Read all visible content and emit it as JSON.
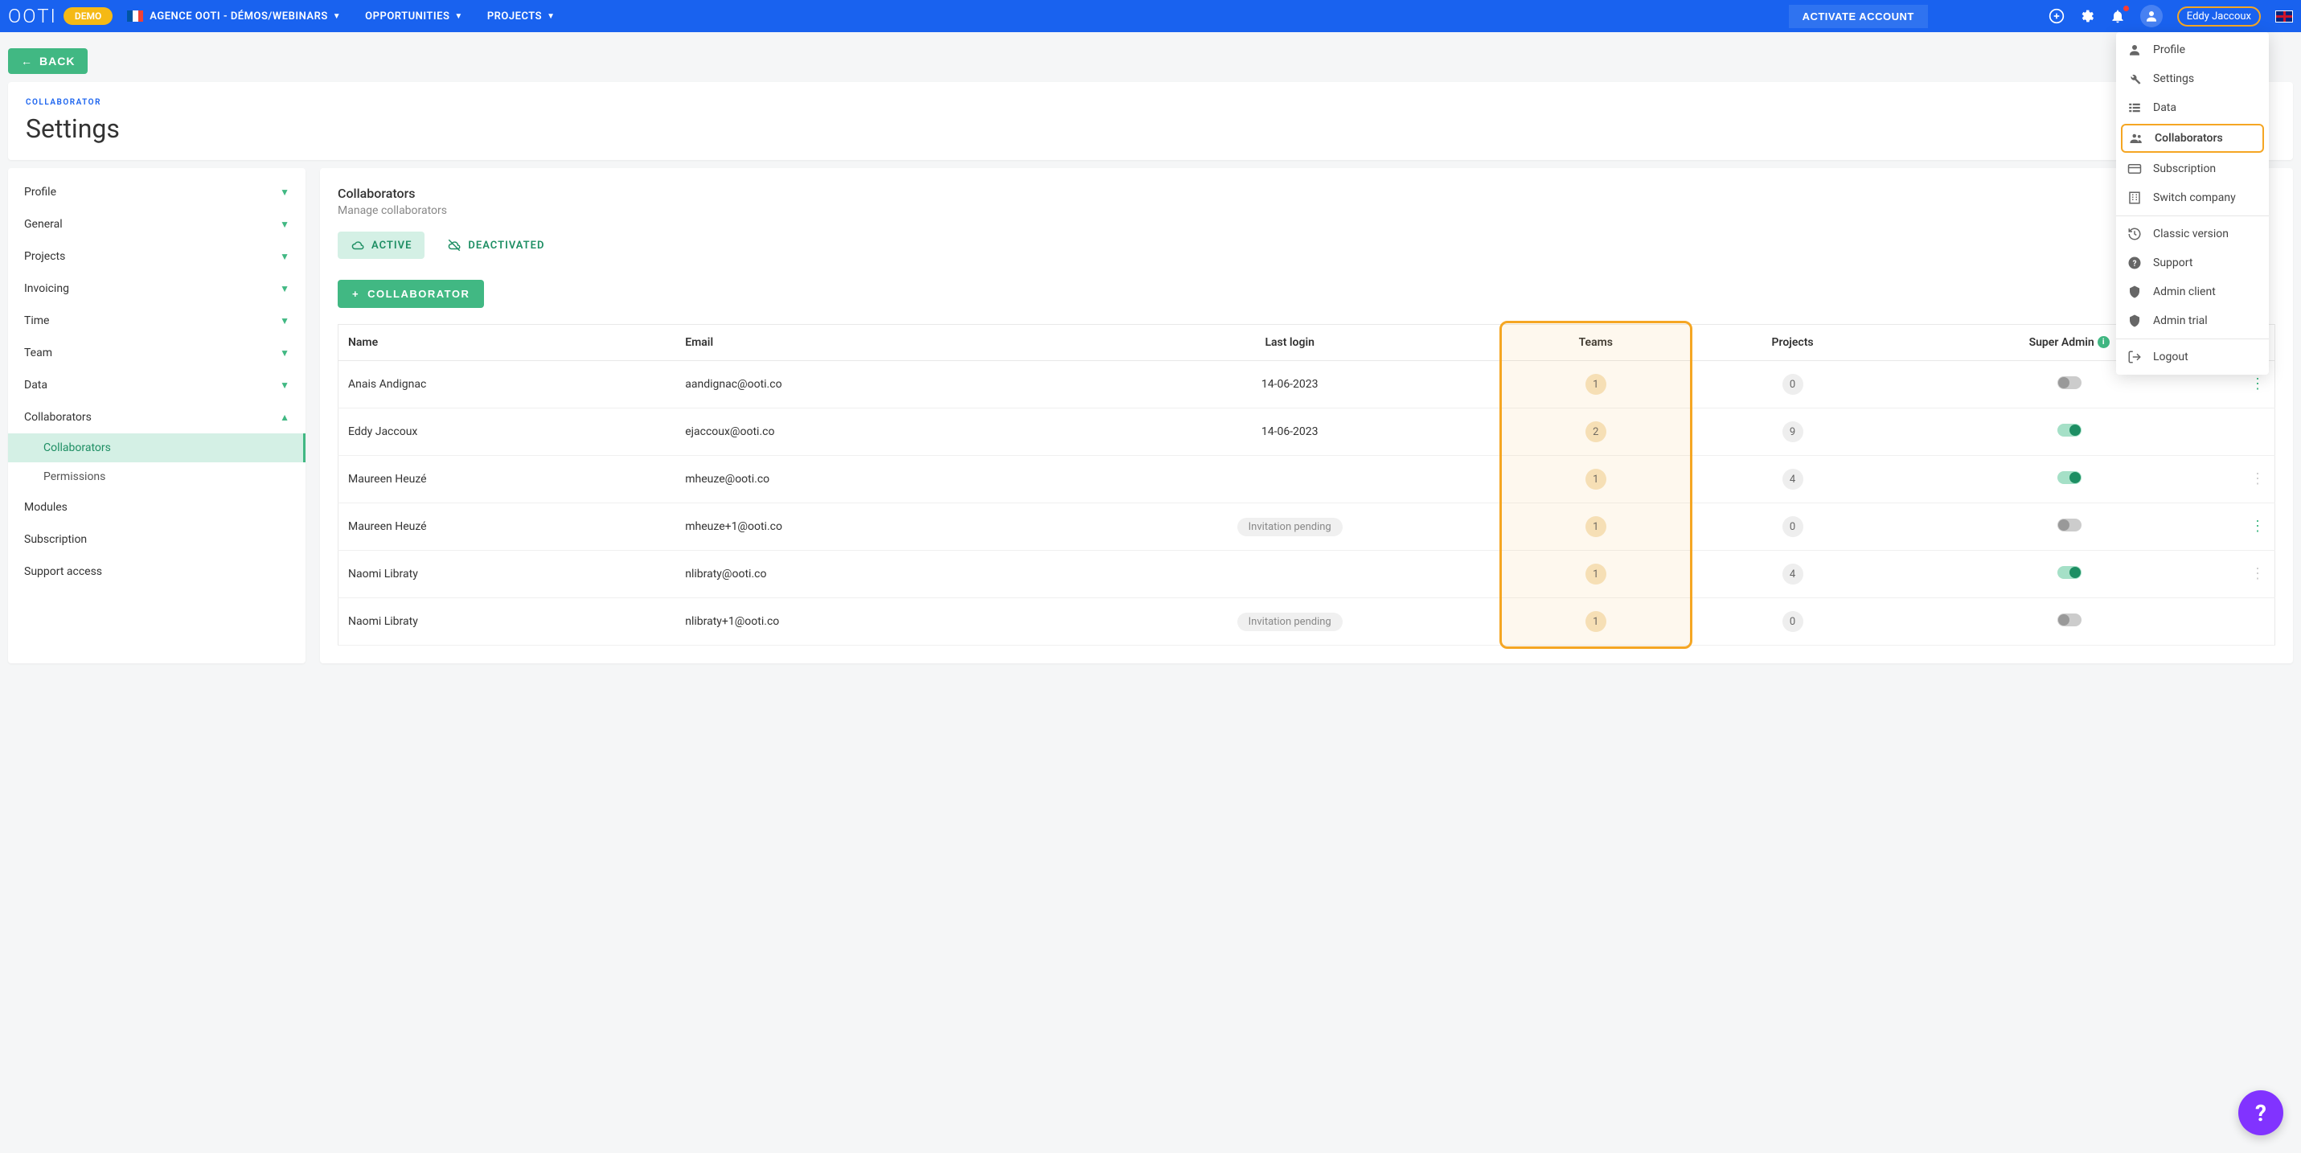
{
  "topbar": {
    "logo": "OOTI",
    "demo_badge": "DEMO",
    "org_name": "AGENCE OOTI - DÉMOS/WEBINARS",
    "nav": {
      "opportunities": "OPPORTUNITIES",
      "projects": "PROJECTS"
    },
    "activate": "ACTIVATE ACCOUNT",
    "user_name": "Eddy Jaccoux"
  },
  "dropdown": {
    "profile": "Profile",
    "settings": "Settings",
    "data": "Data",
    "collaborators": "Collaborators",
    "subscription": "Subscription",
    "switch_company": "Switch company",
    "classic_version": "Classic version",
    "support": "Support",
    "admin_client": "Admin client",
    "admin_trial": "Admin trial",
    "logout": "Logout"
  },
  "back_label": "BACK",
  "eyebrow": "COLLABORATOR",
  "page_title": "Settings",
  "sidebar": {
    "profile": "Profile",
    "general": "General",
    "projects": "Projects",
    "invoicing": "Invoicing",
    "time": "Time",
    "team": "Team",
    "data": "Data",
    "collaborators": "Collaborators",
    "collaborators_sub": "Collaborators",
    "permissions_sub": "Permissions",
    "modules": "Modules",
    "subscription": "Subscription",
    "support_access": "Support access"
  },
  "main": {
    "title": "Collaborators",
    "subtitle": "Manage collaborators",
    "tab_active": "ACTIVE",
    "tab_deactivated": "DEACTIVATED",
    "add_button": "COLLABORATOR",
    "headers": {
      "name": "Name",
      "email": "Email",
      "last_login": "Last login",
      "teams": "Teams",
      "projects": "Projects",
      "super_admin": "Super Admin"
    },
    "pending_label": "Invitation pending",
    "rows": [
      {
        "name": "Anais Andignac",
        "email": "aandignac@ooti.co",
        "last_login": "14-06-2023",
        "teams": "1",
        "projects": "0",
        "admin": false,
        "more": "green"
      },
      {
        "name": "Eddy Jaccoux",
        "email": "ejaccoux@ooti.co",
        "last_login": "14-06-2023",
        "teams": "2",
        "projects": "9",
        "admin": true,
        "more": ""
      },
      {
        "name": "Maureen Heuzé",
        "email": "mheuze@ooti.co",
        "last_login": "",
        "teams": "1",
        "projects": "4",
        "admin": true,
        "more": "muted"
      },
      {
        "name": "Maureen Heuzé",
        "email": "mheuze+1@ooti.co",
        "last_login": "pending",
        "teams": "1",
        "projects": "0",
        "admin": false,
        "more": "green"
      },
      {
        "name": "Naomi Libraty",
        "email": "nlibraty@ooti.co",
        "last_login": "",
        "teams": "1",
        "projects": "4",
        "admin": true,
        "more": "muted"
      },
      {
        "name": "Naomi Libraty",
        "email": "nlibraty+1@ooti.co",
        "last_login": "pending",
        "teams": "1",
        "projects": "0",
        "admin": false,
        "more": ""
      }
    ]
  },
  "help": "?"
}
